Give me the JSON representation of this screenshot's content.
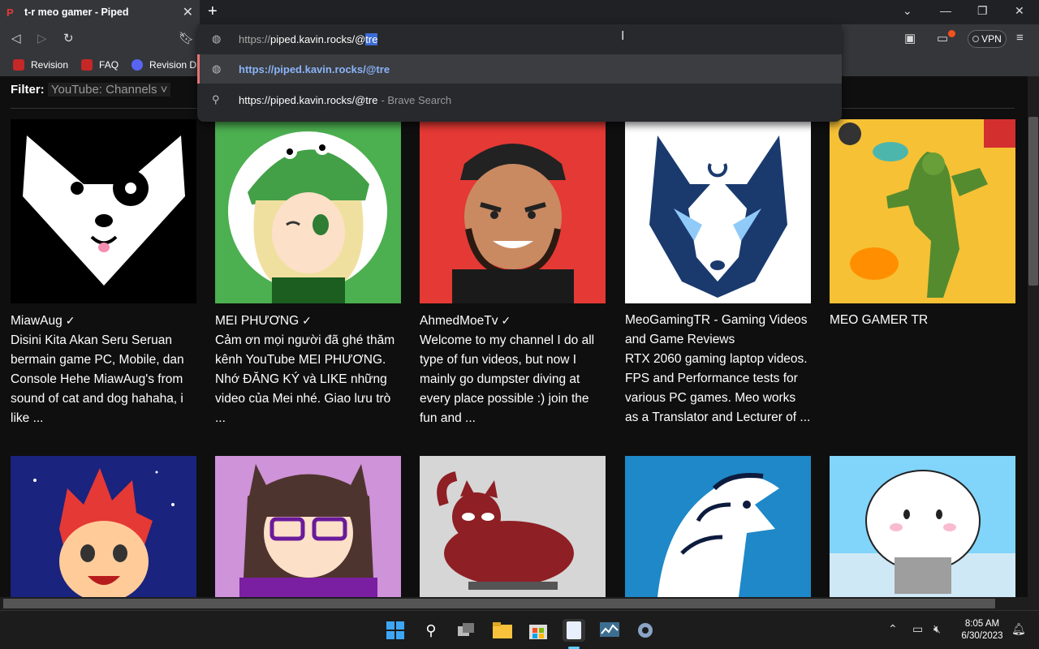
{
  "tab": {
    "title": "t-r meo gamer - Piped",
    "favicon": "P"
  },
  "toolbar": {
    "vpn_label": "VPN"
  },
  "bookmarks": [
    {
      "label": "Revision",
      "color": "#c62828"
    },
    {
      "label": "FAQ",
      "color": "#c62828"
    },
    {
      "label": "Revision Di",
      "color": "#5865f2"
    }
  ],
  "omnibox": {
    "typed_prefix": "https://",
    "typed_host": "piped.kavin.rocks/@",
    "typed_selected": "tre",
    "suggestion_url": "https://piped.kavin.rocks/@tre",
    "search_query": "https://piped.kavin.rocks/@tre",
    "search_engine": "- Brave Search"
  },
  "filter": {
    "label": "Filter:",
    "value": "YouTube: Channels"
  },
  "channels": [
    {
      "name": "MiawAug",
      "verified": true,
      "desc": "Disini Kita Akan Seru Seruan bermain game PC, Mobile, dan Console Hehe MiawAug's from sound of cat and dog hahaha, i like ..."
    },
    {
      "name": "MEI PHƯƠNG",
      "verified": true,
      "desc": "Cảm ơn mọi người đã ghé thăm kênh YouTube MEI PHƯƠNG. Nhớ ĐĂNG KÝ và LIKE những video của Mei nhé. Giao lưu trò ..."
    },
    {
      "name": "AhmedMoeTv",
      "verified": true,
      "desc": "Welcome to my channel I do all type of fun videos, but now I mainly go dumpster diving at every place possible :) join the fun and ..."
    },
    {
      "name": "MeoGamingTR - Gaming Videos and Game Reviews",
      "verified": false,
      "desc": "RTX 2060 gaming laptop videos. FPS and Performance tests for various PC games. Meo works as a Translator and Lecturer of ..."
    },
    {
      "name": "MEO GAMER TR",
      "verified": false,
      "desc": ""
    }
  ],
  "check_glyph": "✓",
  "clock": {
    "time": "8:05 AM",
    "date": "6/30/2023"
  }
}
